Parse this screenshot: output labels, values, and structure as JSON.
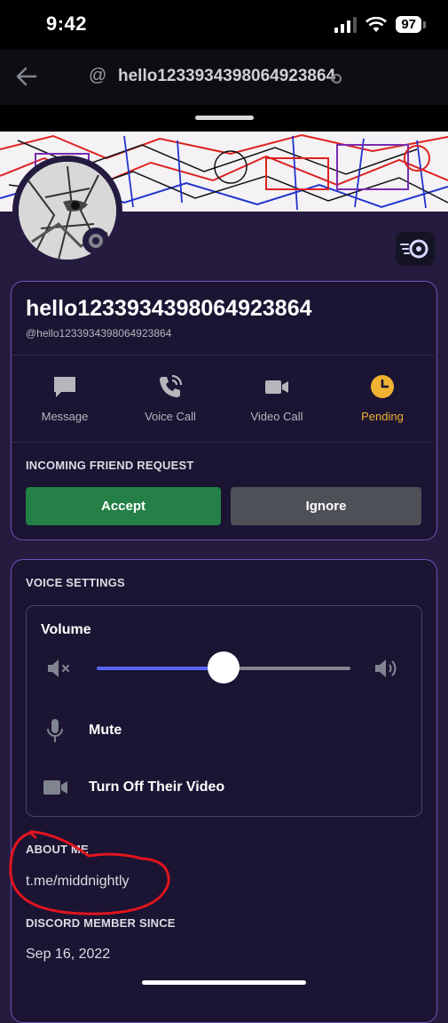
{
  "status_bar": {
    "time": "9:42",
    "battery": "97"
  },
  "nav": {
    "at_symbol": "@",
    "title": "hello1233934398064923864"
  },
  "profile": {
    "display_name": "hello1233934398064923864",
    "handle": "@hello1233934398064923864"
  },
  "actions": [
    {
      "label": "Message",
      "icon": "chat-bubble-icon"
    },
    {
      "label": "Voice Call",
      "icon": "phone-icon"
    },
    {
      "label": "Video Call",
      "icon": "video-camera-icon"
    },
    {
      "label": "Pending",
      "icon": "clock-icon"
    }
  ],
  "friend_request": {
    "title": "INCOMING FRIEND REQUEST",
    "accept": "Accept",
    "ignore": "Ignore"
  },
  "voice_settings": {
    "title": "VOICE SETTINGS",
    "volume_label": "Volume",
    "volume_level": 0.5,
    "mute_label": "Mute",
    "video_label": "Turn Off Their Video"
  },
  "about_me": {
    "title": "ABOUT ME",
    "text": "t.me/middnightly"
  },
  "member_since": {
    "title": "DISCORD MEMBER SINCE",
    "date": "Sep 16, 2022"
  },
  "colors": {
    "background": "#241b3f",
    "card": "#1b1433",
    "accept": "#248046",
    "ignore": "#4e5058",
    "pending": "#f0b232",
    "slider": "#5865f2",
    "annotation": "#e0141e"
  }
}
